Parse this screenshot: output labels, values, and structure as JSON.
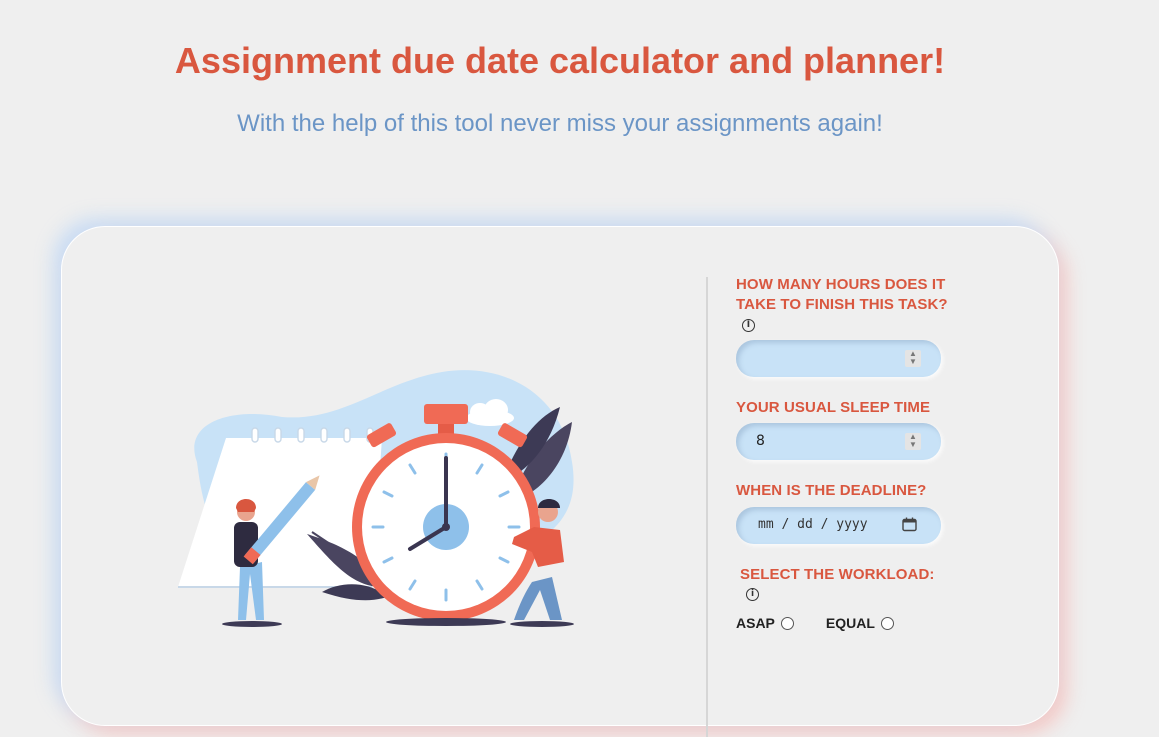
{
  "header": {
    "title": "Assignment due date calculator and planner!",
    "subtitle": "With the help of this tool never miss your assignments again!"
  },
  "form": {
    "hours_label": "HOW MANY HOURS DOES IT TAKE TO FINISH THIS TASK?",
    "hours_value": "",
    "sleep_label": "YOUR USUAL SLEEP TIME",
    "sleep_value": "8",
    "deadline_label": "WHEN IS THE DEADLINE?",
    "deadline_placeholder": "mm / dd / yyyy",
    "workload_label": "SELECT THE WORKLOAD:",
    "workload_options": [
      {
        "label": "ASAP",
        "selected": false
      },
      {
        "label": "EQUAL",
        "selected": false
      }
    ]
  },
  "icons": {
    "info": "info-icon",
    "calendar": "calendar-icon",
    "spinner": "spinner-arrows-icon"
  },
  "colors": {
    "accent": "#d9573f",
    "subtitle": "#6b95c6",
    "field_bg": "#c8e2f7",
    "page_bg": "#efefef"
  }
}
